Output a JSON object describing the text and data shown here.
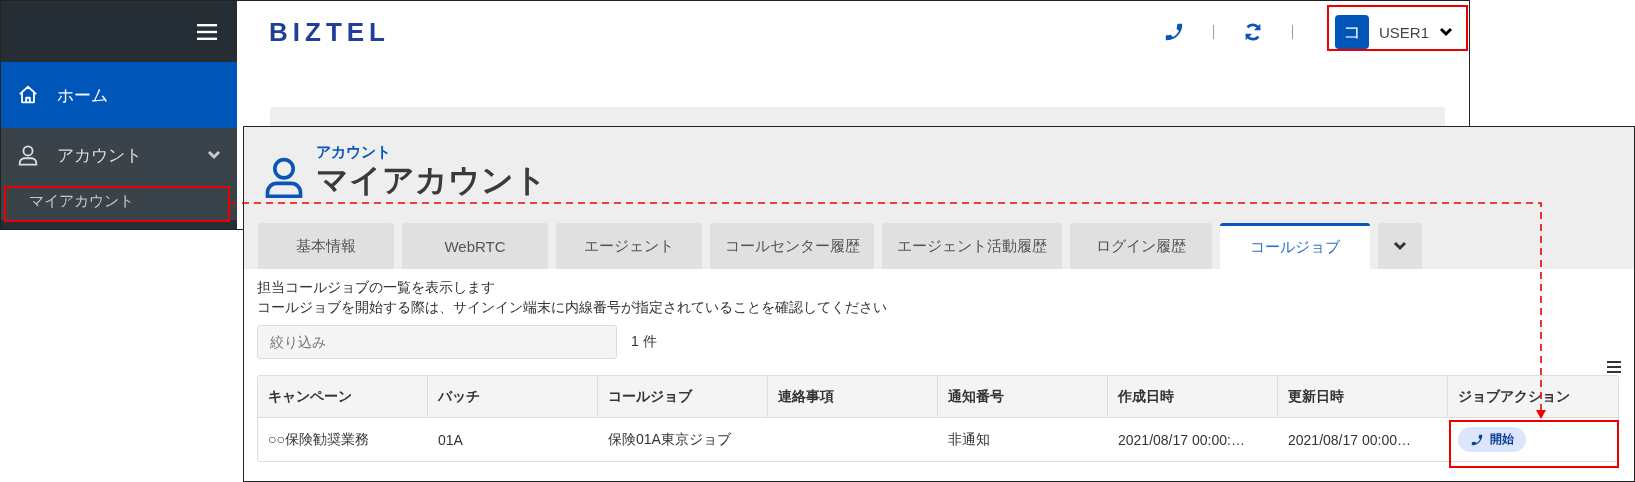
{
  "sidebar": {
    "items": [
      {
        "label": "ホーム",
        "selected": true
      },
      {
        "label": "アカウント",
        "selected": false,
        "expanded": true,
        "children": [
          {
            "label": "マイアカウント",
            "selected": false
          }
        ]
      }
    ]
  },
  "header": {
    "logo": "BIZTEL",
    "user": {
      "avatar": "コ",
      "name": "USER1"
    }
  },
  "page": {
    "breadcrumb": "アカウント",
    "title": "マイアカウント",
    "tabs": [
      {
        "label": "基本情報",
        "selected": false
      },
      {
        "label": "WebRTC",
        "selected": false
      },
      {
        "label": "エージェント",
        "selected": false
      },
      {
        "label": "コールセンター履歴",
        "selected": false
      },
      {
        "label": "エージェント活動履歴",
        "selected": false
      },
      {
        "label": "ログイン履歴",
        "selected": false
      },
      {
        "label": "コールジョブ",
        "selected": true
      }
    ],
    "description": [
      "担当コールジョブの一覧を表示します",
      "コールジョブを開始する際は、サインイン端末に内線番号が指定されていることを確認してください"
    ],
    "filter": {
      "placeholder": "絞り込み"
    },
    "count": "1 件",
    "table": {
      "columns": [
        "キャンペーン",
        "バッチ",
        "コールジョブ",
        "連絡事項",
        "通知番号",
        "作成日時",
        "更新日時",
        "ジョブアクション"
      ],
      "rows": [
        {
          "cells": [
            "○○保険勧奨業務",
            "01A",
            "保険01A東京ジョブ",
            "",
            "非通知",
            "2021/08/17 00:00:…",
            "2021/08/17 00:00…"
          ],
          "action": "開始"
        }
      ]
    }
  }
}
